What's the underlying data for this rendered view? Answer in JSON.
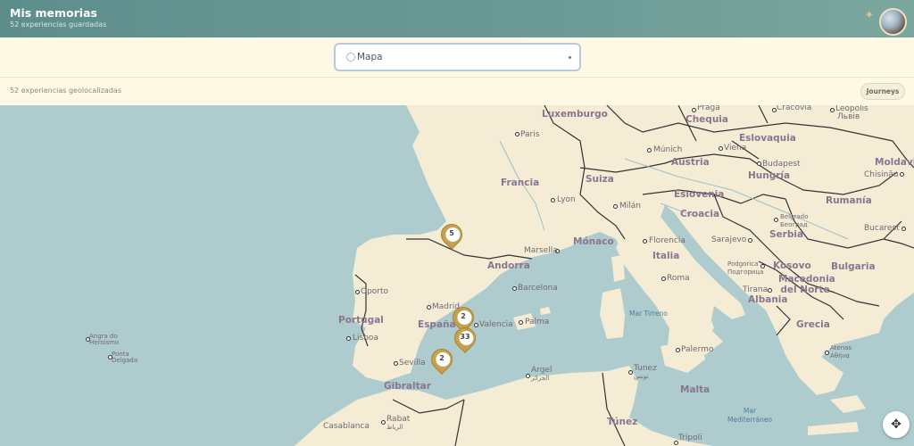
{
  "header": {
    "title": "Mis memorias",
    "subtitle": "52 experiencias guardadas"
  },
  "selector": {
    "selected": "Mapa"
  },
  "infobar": {
    "count": "52 experiencias geolocalizadas",
    "journeys_label": "Journeys"
  },
  "map": {
    "countries": [
      "Luxemburgo",
      "Chequia",
      "Eslovaquia",
      "Francia",
      "Austria",
      "Hungría",
      "Moldavia",
      "Suiza",
      "Eslovenia",
      "Rumanía",
      "Croacia",
      "Mónaco",
      "Serbia",
      "Andorra",
      "Italia",
      "Kosovo",
      "Bulgaria",
      "Macedonia del Norte",
      "Portugal",
      "España",
      "Albania",
      "Grecia",
      "Malta",
      "Túnez",
      "Gibraltar"
    ],
    "cities": [
      "Praga",
      "Cracovia",
      "Leópolis",
      "Львів",
      "Paris",
      "Múnich",
      "Viena",
      "Budapest",
      "Chisinău",
      "Lyon",
      "Milán",
      "Belgrado",
      "Београд",
      "Bucarest",
      "Florencia",
      "Sarajevo",
      "Marsella",
      "Podgorica",
      "Подгорица",
      "Oporto",
      "Barcelona",
      "Roma",
      "Tirana",
      "Madrid",
      "Palma",
      "Valencia",
      "Lisboa",
      "Sevilla",
      "Argel",
      "الجزائر",
      "Tunez",
      "تونس",
      "Palermo",
      "Atenas",
      "Αθήνα",
      "Rabat",
      "الرباط",
      "Casablanca",
      "Trípoli",
      "Angra do Heroísmo",
      "Ponta Delgada"
    ],
    "seas": [
      "Mar Tirreno",
      "Mar Mediterráneo"
    ],
    "clusters": [
      {
        "count": "5"
      },
      {
        "count": "2"
      },
      {
        "count": "33"
      },
      {
        "count": "2"
      }
    ]
  },
  "icons": {
    "sparkle": "sparkle-icon",
    "avatar": "avatar",
    "locate": "locate-icon"
  },
  "colors": {
    "header": "#5e8e8c",
    "marker": "#c7a24e",
    "sea": "#aecbcd",
    "land": "#f4ecd4"
  }
}
